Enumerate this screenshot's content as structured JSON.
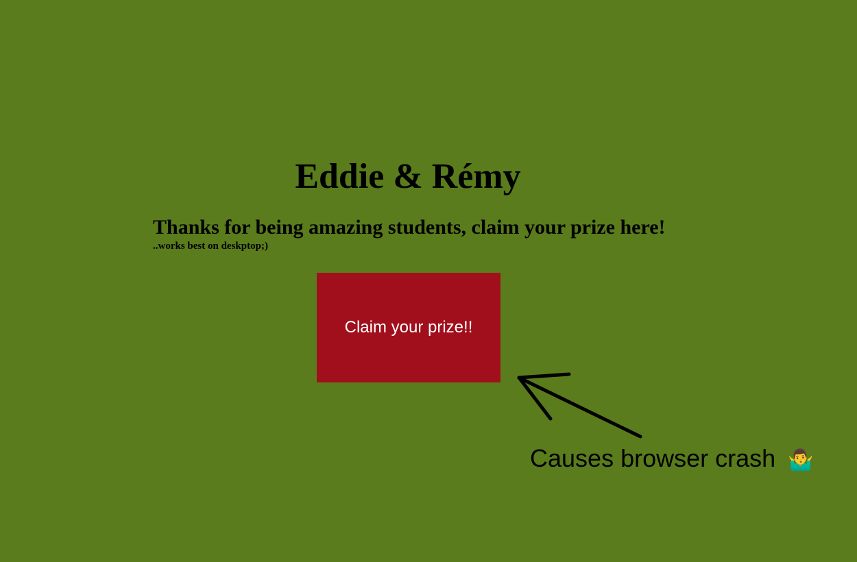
{
  "page": {
    "title": "Eddie & Rémy",
    "subtitle": "Thanks for being amazing students, claim your prize here!",
    "hint": "..works best on deskptop;)"
  },
  "button": {
    "label": "Claim your prize!!",
    "background": "#a10f1c",
    "text_color": "#ffffff"
  },
  "annotation": {
    "text": "Causes browser crash",
    "emoji": "🤷‍♂️"
  },
  "colors": {
    "background": "#5a7c1c"
  }
}
